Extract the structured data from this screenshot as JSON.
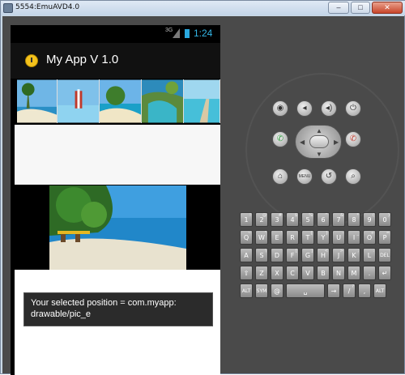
{
  "window": {
    "title": "5554:EmuAVD4.0",
    "minimize": "–",
    "maximize": "□",
    "close": "✕"
  },
  "statusbar": {
    "network": "3G",
    "time": "1:24"
  },
  "app": {
    "title": "My App V 1.0"
  },
  "gallery": {
    "thumbnails": [
      "pic_a",
      "pic_b",
      "pic_c",
      "pic_d",
      "pic_e"
    ]
  },
  "toast": {
    "message": "Your selected position = com.myapp: drawable/pic_e"
  },
  "controls": {
    "camera_icon": "camera-icon",
    "volume_down_icon": "volume-down-icon",
    "volume_up_icon": "volume-up-icon",
    "power_icon": "power-icon",
    "call_icon": "call-icon",
    "end_call_icon": "end-call-icon",
    "home_icon": "home-icon",
    "menu_label": "MENU",
    "back_icon": "back-icon",
    "search_icon": "search-icon"
  },
  "keyboard": {
    "rows": [
      [
        {
          "k": "1",
          "s": "!"
        },
        {
          "k": "2",
          "s": "@"
        },
        {
          "k": "3",
          "s": "#"
        },
        {
          "k": "4",
          "s": "$"
        },
        {
          "k": "5",
          "s": "%"
        },
        {
          "k": "6",
          "s": "^"
        },
        {
          "k": "7",
          "s": "&"
        },
        {
          "k": "8",
          "s": "*"
        },
        {
          "k": "9",
          "s": "("
        },
        {
          "k": "0",
          "s": ")"
        }
      ],
      [
        {
          "k": "Q",
          "s": "~"
        },
        {
          "k": "W",
          "s": "\""
        },
        {
          "k": "E",
          "s": "'"
        },
        {
          "k": "R",
          "s": ""
        },
        {
          "k": "T",
          "s": "{"
        },
        {
          "k": "Y",
          "s": "}"
        },
        {
          "k": "U",
          "s": "-"
        },
        {
          "k": "I",
          "s": "_"
        },
        {
          "k": "O",
          "s": "+"
        },
        {
          "k": "P",
          "s": "="
        }
      ],
      [
        {
          "k": "A",
          "s": ""
        },
        {
          "k": "S",
          "s": "\\"
        },
        {
          "k": "D",
          "s": ""
        },
        {
          "k": "F",
          "s": "["
        },
        {
          "k": "G",
          "s": "]"
        },
        {
          "k": "H",
          "s": "<"
        },
        {
          "k": "J",
          "s": ">"
        },
        {
          "k": "K",
          "s": ";"
        },
        {
          "k": "L",
          "s": ":"
        },
        {
          "k": "DEL",
          "s": ""
        }
      ],
      [
        {
          "k": "⇧",
          "s": ""
        },
        {
          "k": "Z",
          "s": ""
        },
        {
          "k": "X",
          "s": ""
        },
        {
          "k": "C",
          "s": ""
        },
        {
          "k": "V",
          "s": ""
        },
        {
          "k": "B",
          "s": ""
        },
        {
          "k": "N",
          "s": ""
        },
        {
          "k": "M",
          "s": ""
        },
        {
          "k": ".",
          "s": ""
        },
        {
          "k": "↵",
          "s": ""
        }
      ],
      [
        {
          "k": "ALT",
          "s": ""
        },
        {
          "k": "SYM",
          "s": ""
        },
        {
          "k": "@",
          "s": ""
        },
        {
          "k": "␣",
          "s": ""
        },
        {
          "k": "→",
          "s": ""
        },
        {
          "k": "/",
          "s": "?"
        },
        {
          "k": ",",
          "s": ""
        },
        {
          "k": "ALT",
          "s": ""
        }
      ]
    ]
  }
}
